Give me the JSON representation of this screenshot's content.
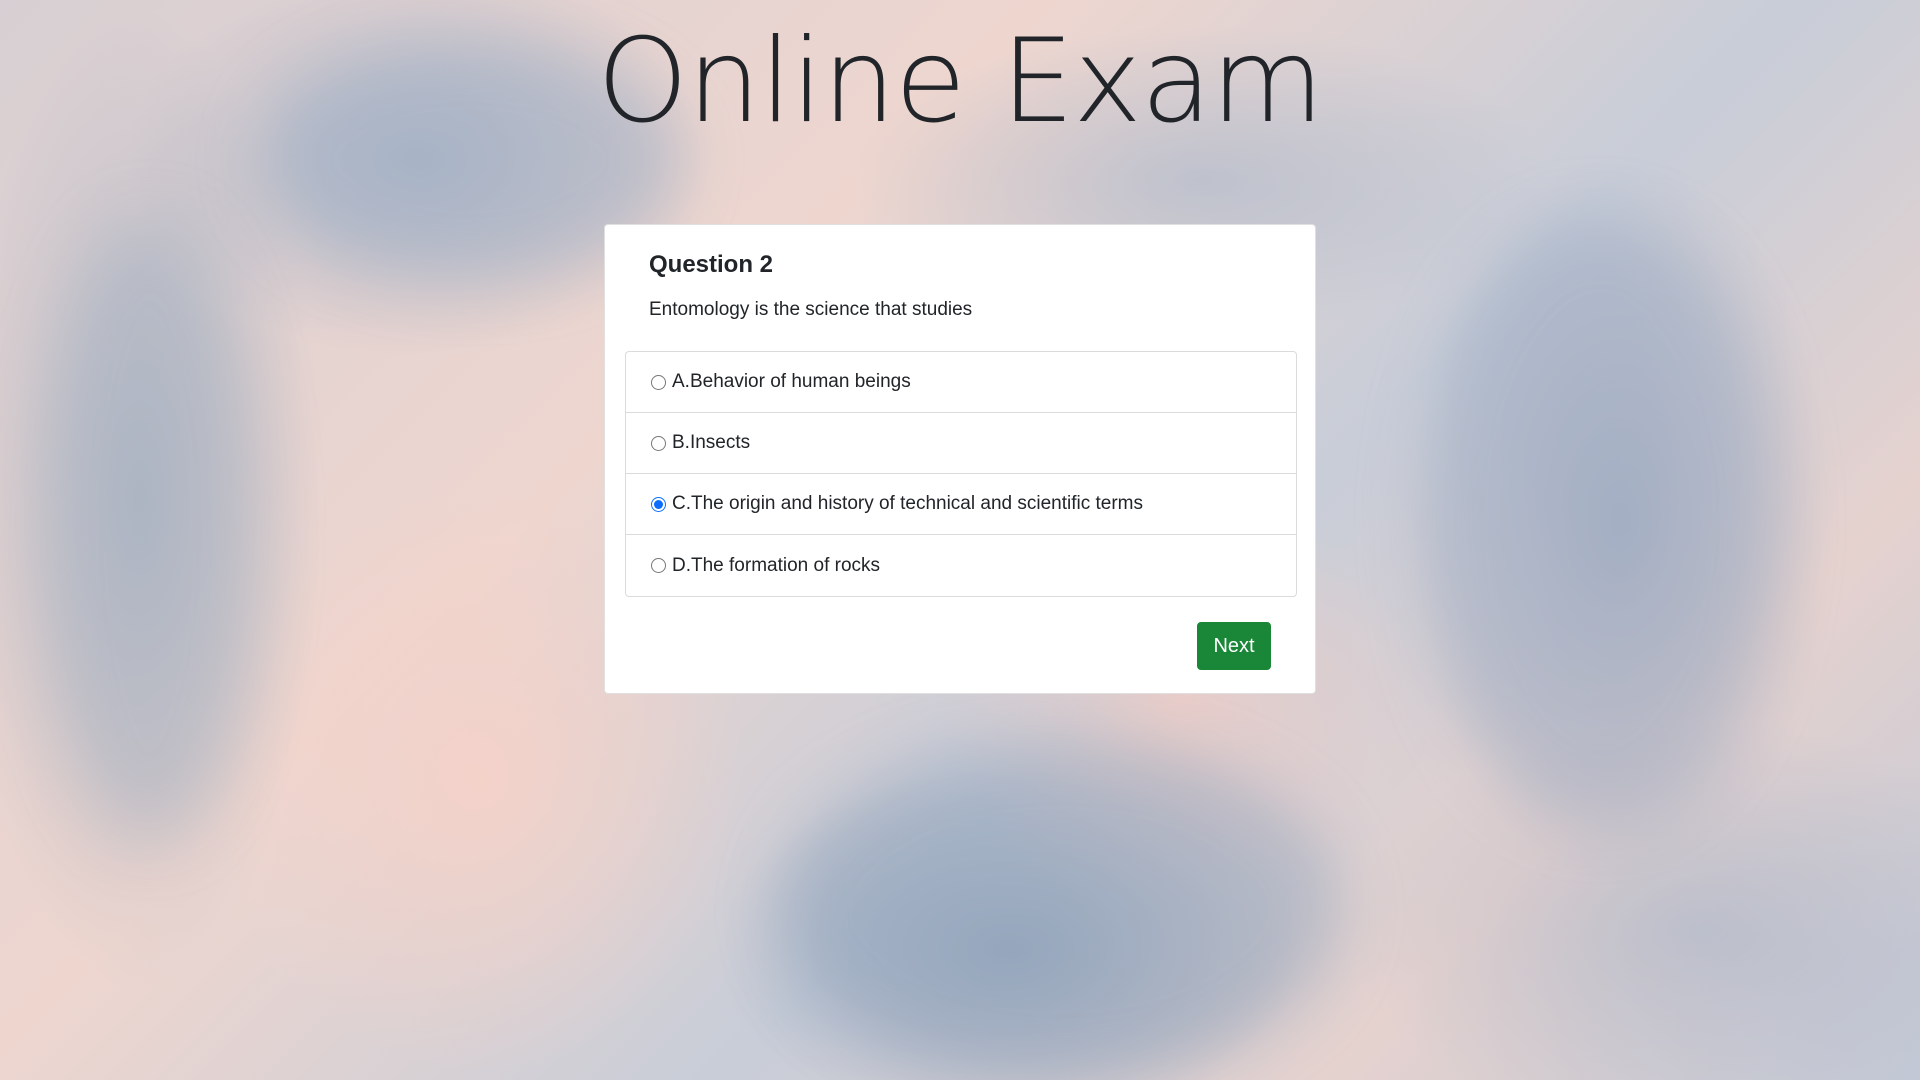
{
  "page": {
    "title": "Online Exam"
  },
  "question": {
    "heading": "Question 2",
    "text": "Entomology is the science that studies",
    "options": [
      {
        "label": "A.Behavior of human beings",
        "selected": false
      },
      {
        "label": "B.Insects",
        "selected": false
      },
      {
        "label": "C.The origin and history of technical and scientific terms",
        "selected": true
      },
      {
        "label": "D.The formation of rocks",
        "selected": false
      }
    ]
  },
  "actions": {
    "next_label": "Next"
  },
  "colors": {
    "next_button": "#198737",
    "radio_selected": "#0d6efd",
    "card_background": "#ffffff"
  }
}
